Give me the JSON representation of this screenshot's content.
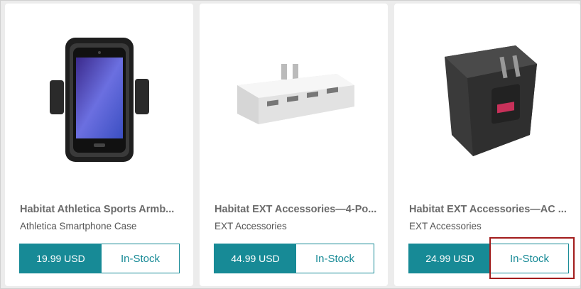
{
  "products": [
    {
      "title": "Habitat Athletica Sports Armb...",
      "subtitle": "Athletica Smartphone Case",
      "price": "19.99 USD",
      "stock": "In-Stock",
      "image": "armband-phone-case"
    },
    {
      "title": "Habitat EXT Accessories—4-Po...",
      "subtitle": "EXT Accessories",
      "price": "44.99 USD",
      "stock": "In-Stock",
      "image": "usb-charging-hub"
    },
    {
      "title": "Habitat EXT Accessories—AC ...",
      "subtitle": "EXT Accessories",
      "price": "24.99 USD",
      "stock": "In-Stock",
      "image": "ac-wall-charger"
    }
  ],
  "colors": {
    "accent": "#178a96",
    "highlight": "#a21c1c"
  }
}
